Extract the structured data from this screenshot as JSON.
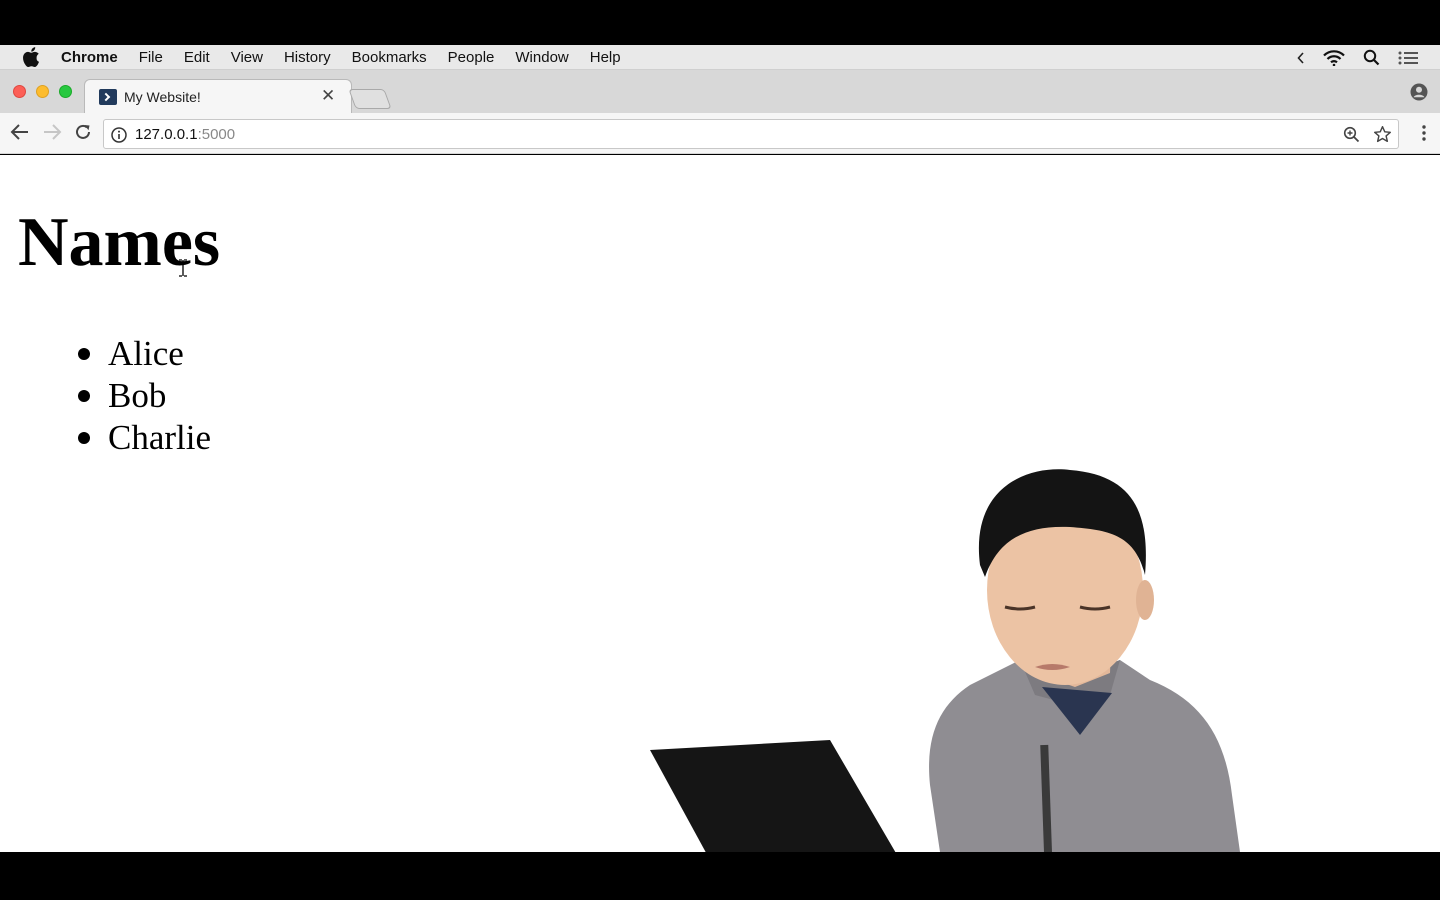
{
  "menubar": {
    "app_name": "Chrome",
    "items": [
      "File",
      "Edit",
      "View",
      "History",
      "Bookmarks",
      "People",
      "Window",
      "Help"
    ]
  },
  "tabs": [
    {
      "title": "My Website!",
      "favicon": "terminal-icon",
      "active": true
    }
  ],
  "toolbar": {
    "url_host": "127.0.0.1",
    "url_port": ":5000"
  },
  "page": {
    "heading": "Names",
    "names": [
      "Alice",
      "Bob",
      "Charlie"
    ]
  },
  "colors": {
    "traffic_close": "#fc5f57",
    "traffic_minimize": "#fdbc2e",
    "traffic_maximize": "#28c840",
    "sweater": "#8f8d92"
  }
}
